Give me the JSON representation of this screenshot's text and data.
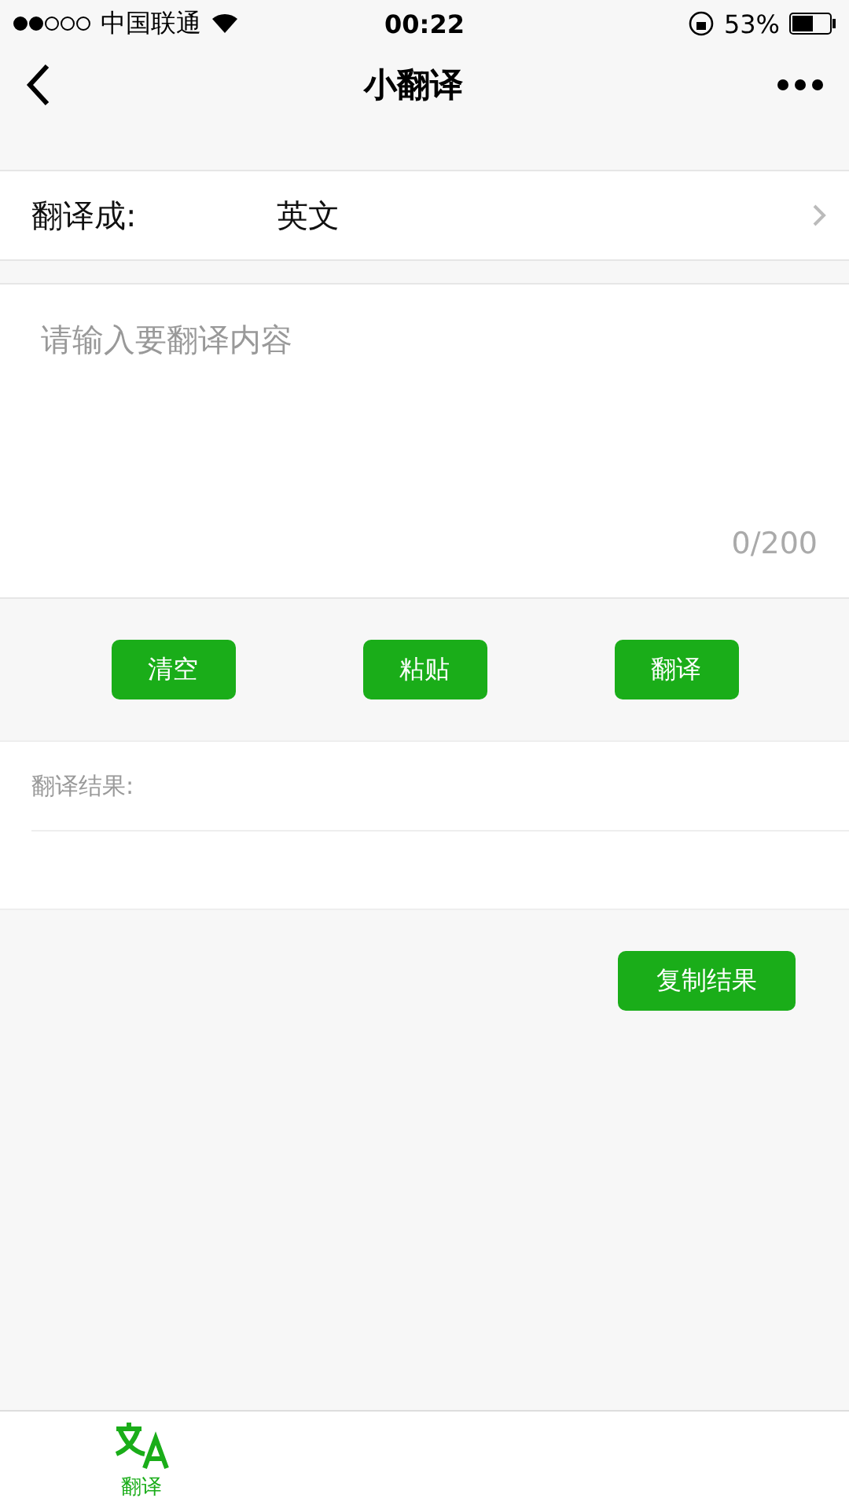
{
  "status_bar": {
    "carrier": "中国联通",
    "time": "00:22",
    "battery": "53%"
  },
  "nav": {
    "title": "小翻译"
  },
  "target_language": {
    "label": "翻译成:",
    "value": "英文"
  },
  "input": {
    "placeholder": "请输入要翻译内容",
    "counter": "0/200"
  },
  "buttons": [
    "清空",
    "粘贴",
    "翻译"
  ],
  "result": {
    "label": "翻译结果:"
  },
  "copy_button": "复制结果",
  "tabs": [
    {
      "label": "翻译",
      "selected": true
    }
  ]
}
